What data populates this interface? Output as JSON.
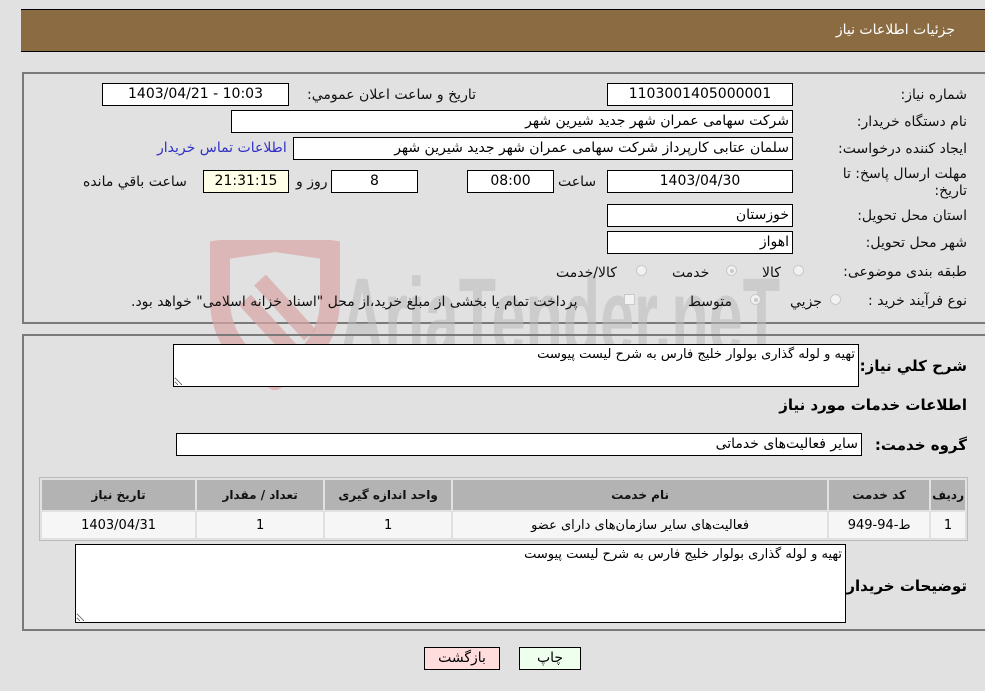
{
  "header": {
    "title": "جزئیات اطلاعات نیاز"
  },
  "form": {
    "need_number": {
      "label": "شماره نیاز:",
      "value": "1103001405000001"
    },
    "announce_datetime": {
      "label": "تاریخ و ساعت اعلان عمومي:",
      "value": "1403/04/21 - 10:03"
    },
    "buyer_org": {
      "label": "نام دستگاه خریدار:",
      "value": "شرکت سهامی عمران شهر جدید شیرین شهر"
    },
    "requester": {
      "label": "ایجاد کننده درخواست:",
      "value": "سلمان عتابی کارپرداز شرکت سهامی عمران شهر جدید شیرین شهر"
    },
    "contact_link": "اطلاعات تماس خریدار",
    "deadline": {
      "label_line1": "مهلت ارسال پاسخ: تا",
      "label_line2": "تاریخ:",
      "date": "1403/04/30",
      "time_label": "ساعت",
      "time": "08:00",
      "days": "8",
      "days_label": "روز و",
      "remaining": "21:31:15",
      "remaining_label": "ساعت باقي مانده"
    },
    "province": {
      "label": "استان محل تحویل:",
      "value": "خوزستان"
    },
    "city": {
      "label": "شهر محل تحویل:",
      "value": "اهواز"
    },
    "category": {
      "label": "طبقه بندی موضوعی:",
      "options": [
        "کالا",
        "خدمت",
        "کالا/خدمت"
      ],
      "selected": "خدمت"
    },
    "purchase_type": {
      "label": "نوع فرآیند خرید :",
      "options": [
        "جزيي",
        "متوسط"
      ],
      "selected": "متوسط",
      "treasury_note": "پرداخت تمام یا بخشی از مبلغ خرید،از محل \"اسناد خزانه اسلامی\" خواهد بود."
    }
  },
  "details": {
    "summary_label": "شرح كلي نياز:",
    "summary_value": "تهیه و لوله گذاری بولوار خلیج فارس به شرح لیست پیوست",
    "services_heading": "اطلاعات خدمات مورد نياز",
    "service_group_label": "گروه خدمت:",
    "service_group_value": "سایر فعالیت‌های خدماتی",
    "table": {
      "headers": [
        "ردیف",
        "کد خدمت",
        "نام خدمت",
        "واحد اندازه گیری",
        "تعداد / مقدار",
        "تاریخ نیاز"
      ],
      "rows": [
        [
          "1",
          "ط-94-949",
          "فعالیت‌های سایر سازمان‌های دارای عضو",
          "1",
          "1",
          "1403/04/31"
        ]
      ]
    },
    "buyer_notes_label": "توضیحات خریدار:",
    "buyer_notes_value": "تهیه و لوله گذاری بولوار خلیج فارس به شرح لیست پیوست"
  },
  "buttons": {
    "print": "چاپ",
    "back": "بازگشت"
  },
  "watermark": {
    "text": "AriaTender.neT"
  },
  "colors": {
    "header_bg": "#8b6b41",
    "link": "#3030c8",
    "print_bg": "#eeffee",
    "back_bg": "#ffdddd"
  }
}
